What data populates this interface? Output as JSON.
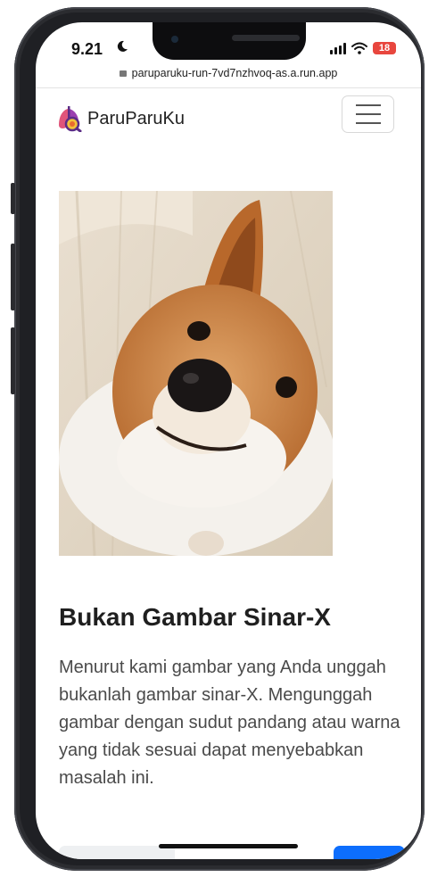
{
  "status_bar": {
    "time": "9.21",
    "battery": "18"
  },
  "browser": {
    "url": "paruparuku-run-7vd7nzhvoq-as.a.run.app"
  },
  "navbar": {
    "brand": "ParuParuKu",
    "menu_icon": "hamburger-icon"
  },
  "main": {
    "image_alt": "dog-photo",
    "heading": "Bukan Gambar Sinar-X",
    "message": "Menurut kami gambar yang Anda unggah bukanlah gambar sinar-X. Mengunggah gambar dengan sudut pandang atau warna yang tidak sesuai dapat menyebabkan masalah ini."
  },
  "colors": {
    "primary_button": "#0d6efd",
    "secondary_button": "#eef0f2",
    "battery": "#e8463e"
  }
}
